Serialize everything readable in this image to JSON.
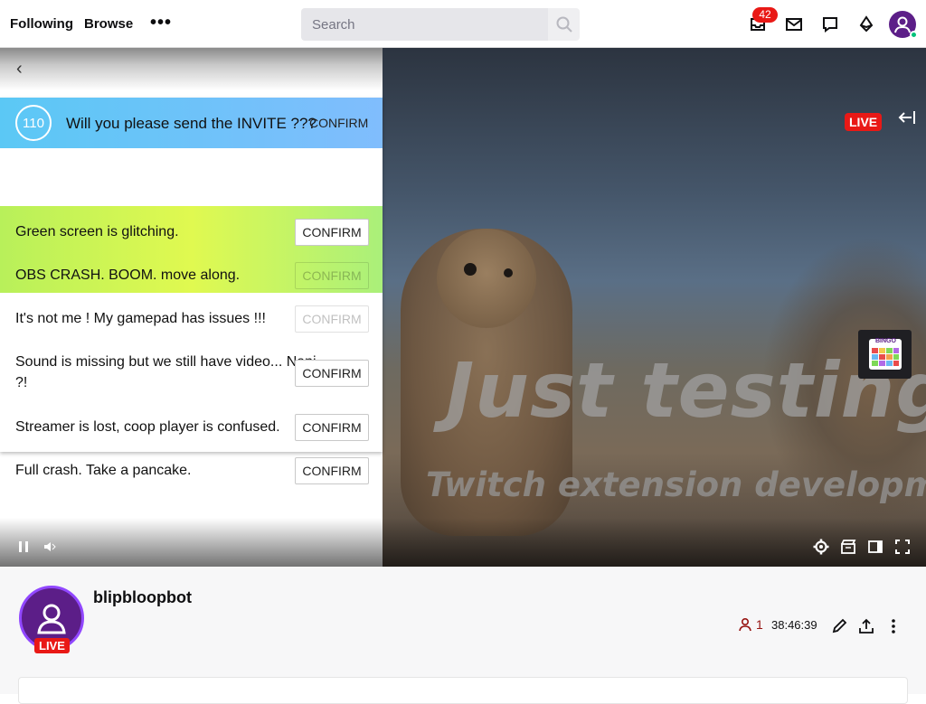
{
  "nav": {
    "following": "Following",
    "browse": "Browse",
    "more": "•••",
    "search_placeholder": "Search",
    "notification_count": "42"
  },
  "player": {
    "live_label": "LIVE",
    "video_title": "Just testing",
    "video_subtitle": "Twitch extension development",
    "extension_name": "BINGO"
  },
  "panel": {
    "invite": {
      "count": "110",
      "text": "Will you please send the INVITE ???",
      "confirm": "CONFIRM"
    },
    "items": [
      {
        "text": "Green screen is glitching.",
        "confirm": "CONFIRM"
      },
      {
        "text": "OBS CRASH. BOOM. move along.",
        "confirm": "CONFIRM"
      },
      {
        "text": "It's not me ! My gamepad has issues !!!",
        "confirm": "CONFIRM"
      },
      {
        "text": "Sound is missing but we still have video... Nani ?!",
        "confirm": "CONFIRM"
      },
      {
        "text": "Streamer is lost, coop player is confused.",
        "confirm": "CONFIRM"
      },
      {
        "text": "Full crash. Take a pancake.",
        "confirm": "CONFIRM"
      }
    ]
  },
  "channel": {
    "name": "blipbloopbot",
    "live_label": "LIVE",
    "viewer_count": "1",
    "uptime": "38:46:39"
  },
  "colors": {
    "accent": "#9147ff",
    "live_red": "#e91916",
    "invite_row": "#5bc8f5",
    "highlight_green": "#c8f552"
  }
}
